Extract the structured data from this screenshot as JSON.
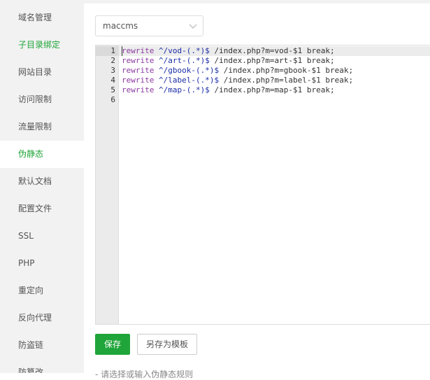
{
  "sidebar": {
    "items": [
      {
        "label": "域名管理"
      },
      {
        "label": "子目录绑定"
      },
      {
        "label": "网站目录"
      },
      {
        "label": "访问限制"
      },
      {
        "label": "流量限制"
      },
      {
        "label": "伪静态"
      },
      {
        "label": "默认文档"
      },
      {
        "label": "配置文件"
      },
      {
        "label": "SSL"
      },
      {
        "label": "PHP"
      },
      {
        "label": "重定向"
      },
      {
        "label": "反向代理"
      },
      {
        "label": "防盗链"
      },
      {
        "label": "防篡改"
      }
    ],
    "active": "伪静态"
  },
  "rewrite_select": {
    "value": "maccms"
  },
  "editor": {
    "lines": [
      {
        "no": "1",
        "kw": "rewrite",
        "pattern": " ^/vod-(.*)$",
        "target": " /index.php?m=vod-$1 break;"
      },
      {
        "no": "2",
        "kw": "rewrite",
        "pattern": " ^/art-(.*)$",
        "target": " /index.php?m=art-$1 break;"
      },
      {
        "no": "3",
        "kw": "rewrite",
        "pattern": " ^/gbook-(.*)$",
        "target": " /index.php?m=gbook-$1 break;"
      },
      {
        "no": "4",
        "kw": "rewrite",
        "pattern": " ^/label-(.*)$",
        "target": " /index.php?m=label-$1 break;"
      },
      {
        "no": "5",
        "kw": "rewrite",
        "pattern": " ^/map-(.*)$",
        "target": " /index.php?m=map-$1 break;"
      },
      {
        "no": "6",
        "kw": "",
        "pattern": "",
        "target": ""
      }
    ]
  },
  "actions": {
    "save_label": "保存",
    "save_as_template_label": "另存为模板"
  },
  "hint": {
    "text": "- 请选择或输入伪静态规则"
  },
  "colors": {
    "accent": "#20a53a",
    "keyword": "#8b3aa0",
    "regex": "#1b2ea6"
  }
}
